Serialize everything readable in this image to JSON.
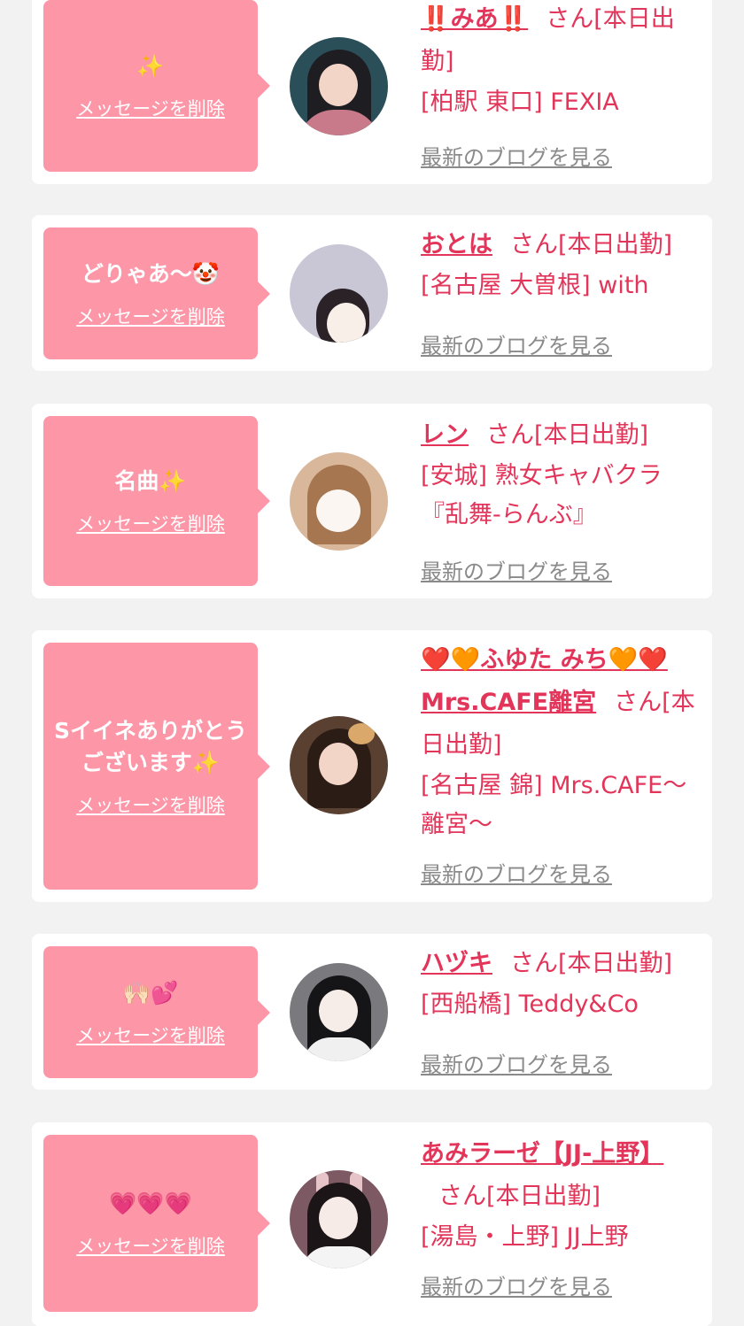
{
  "common": {
    "delete_label": "メッセージを削除",
    "blog_label": "最新のブログを見る",
    "accent_color": "#e3355a",
    "bubble_color": "#fd96a7"
  },
  "entries": [
    {
      "message": "✨",
      "name": "‼️みあ‼️",
      "suffix": "さん[本日出勤]",
      "shop": "[柏駅 東口] FEXIA",
      "avatar": "avatar-photo"
    },
    {
      "message": "どりゃあ〜🤡",
      "name": "おとは",
      "suffix": "さん[本日出勤]",
      "shop": "[名古屋 大曽根] with",
      "avatar": "avatar-photo"
    },
    {
      "message": "名曲✨",
      "name": "レン",
      "suffix": "さん[本日出勤]",
      "shop": "[安城] 熟女キャバクラ『乱舞-らんぶ』",
      "avatar": "avatar-photo"
    },
    {
      "message": "Sイイネありがとうございます✨",
      "name": "❤️🧡ふゆた みち🧡❤️Mrs.CAFE離宮",
      "suffix": "さん[本日出勤]",
      "shop": "[名古屋 錦] Mrs.CAFE〜離宮〜",
      "avatar": "avatar-photo"
    },
    {
      "message": "🙌🏻💕",
      "name": "ハヅキ",
      "suffix": "さん[本日出勤]",
      "shop": "[西船橋] Teddy&Co",
      "avatar": "avatar-photo"
    },
    {
      "message": "💗💗💗",
      "name": "あみラーゼ【JJ-上野】",
      "suffix": "さん[本日出勤]",
      "shop": "[湯島・上野] JJ上野",
      "avatar": "avatar-photo"
    }
  ]
}
